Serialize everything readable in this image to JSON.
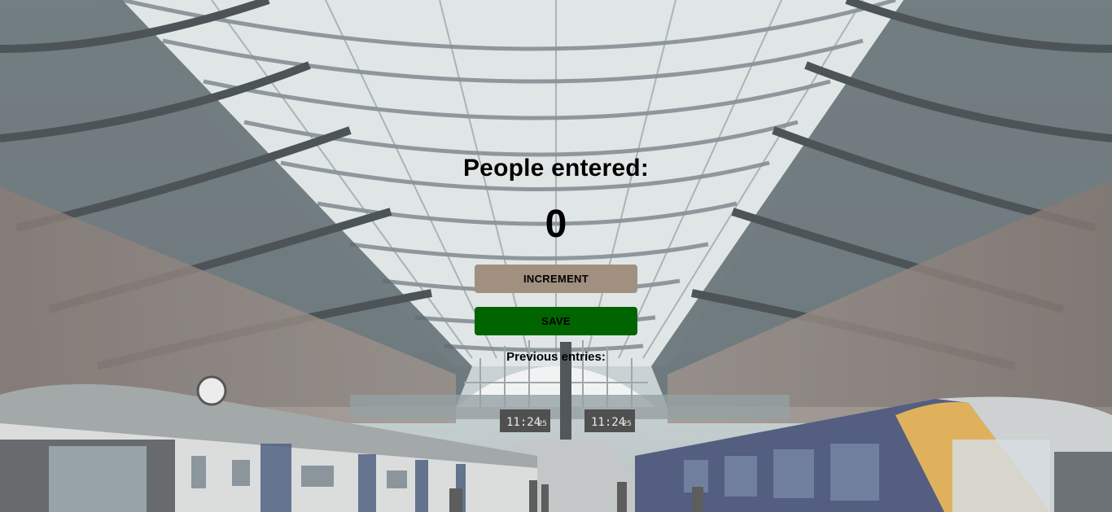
{
  "counter": {
    "title": "People entered:",
    "count": "0",
    "increment_label": "INCREMENT",
    "save_label": "SAVE",
    "previous_entries_label": "Previous entries:"
  },
  "background": {
    "description_icon": "train-station-photo",
    "board_left_time": "11:24",
    "board_left_seconds": "25",
    "board_right_time": "11:24",
    "board_right_seconds": "25"
  },
  "colors": {
    "increment_button": "#a18f7f",
    "save_button": "#006400",
    "text": "#000000"
  }
}
